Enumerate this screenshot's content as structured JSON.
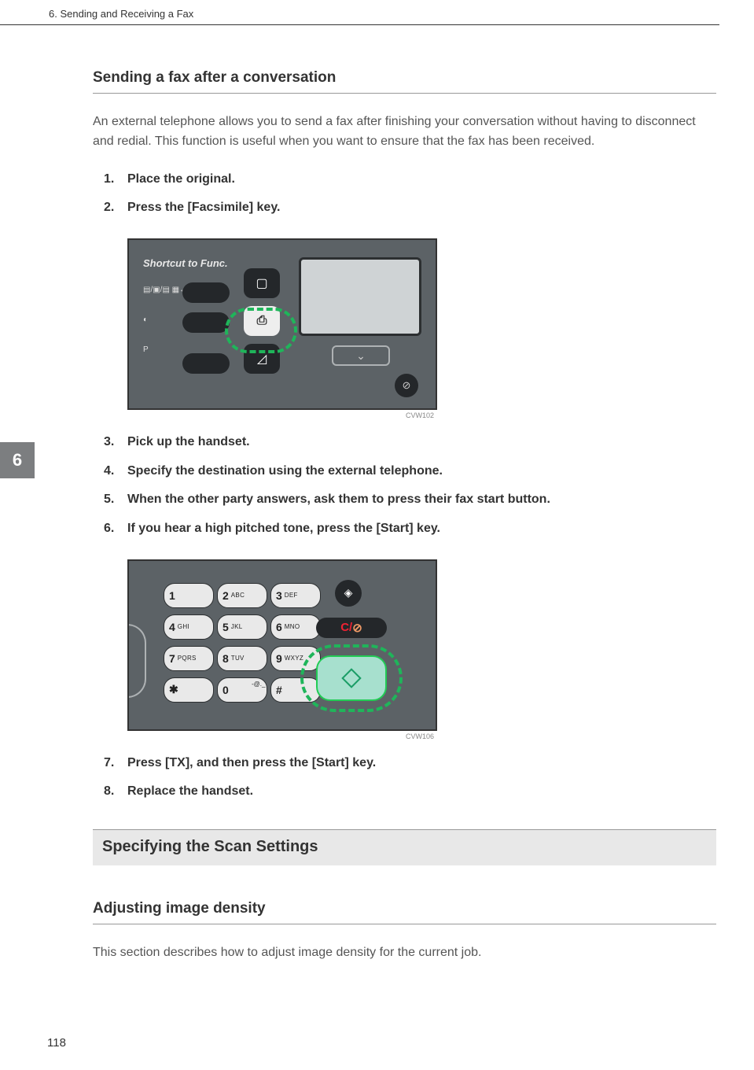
{
  "header": {
    "chapter_title": "6. Sending and Receiving a Fax"
  },
  "chapter_tab": "6",
  "page_number": "118",
  "section1": {
    "heading": "Sending a fax after a conversation",
    "intro": "An external telephone allows you to send a fax after finishing your conversation without having to disconnect and redial. This function is useful when you want to ensure that the fax has been received.",
    "steps": [
      "Place the original.",
      "Press the [Facsimile] key.",
      "Pick up the handset.",
      "Specify the destination using the external telephone.",
      "When the other party answers, ask them to press their fax start button.",
      "If you hear a high pitched tone, press the [Start] key.",
      "Press [TX], and then press the [Start] key.",
      "Replace the handset."
    ]
  },
  "figure1": {
    "shortcut_label": "Shortcut to Func.",
    "side": {
      "row1": "▤/▣/▤ ▦↔▦",
      "row2": "◐",
      "row3": "P"
    },
    "mid": {
      "copy": "▢",
      "fax": "⎙",
      "scan": "◿"
    },
    "down_arrow": "⌄",
    "pause": "⊘",
    "caption": "CVW102"
  },
  "figure2": {
    "keys": [
      {
        "n": "1",
        "s": ""
      },
      {
        "n": "2",
        "s": "ABC"
      },
      {
        "n": "3",
        "s": "DEF"
      },
      {
        "n": "4",
        "s": "GHI"
      },
      {
        "n": "5",
        "s": "JKL"
      },
      {
        "n": "6",
        "s": "MNO"
      },
      {
        "n": "7",
        "s": "PQRS"
      },
      {
        "n": "8",
        "s": "TUV"
      },
      {
        "n": "9",
        "s": "WXYZ"
      },
      {
        "n": "✱",
        "s": ""
      },
      {
        "n": "0",
        "s": ""
      },
      {
        "n": "#",
        "s": ""
      }
    ],
    "tiny": "-@._",
    "esc": "◈",
    "clear": {
      "c": "C",
      "slash": "/",
      "stop": "⊘"
    },
    "caption": "CVW106"
  },
  "section2": {
    "heading": "Specifying the Scan Settings",
    "sub_heading": "Adjusting image density",
    "body": "This section describes how to adjust image density for the current job."
  }
}
